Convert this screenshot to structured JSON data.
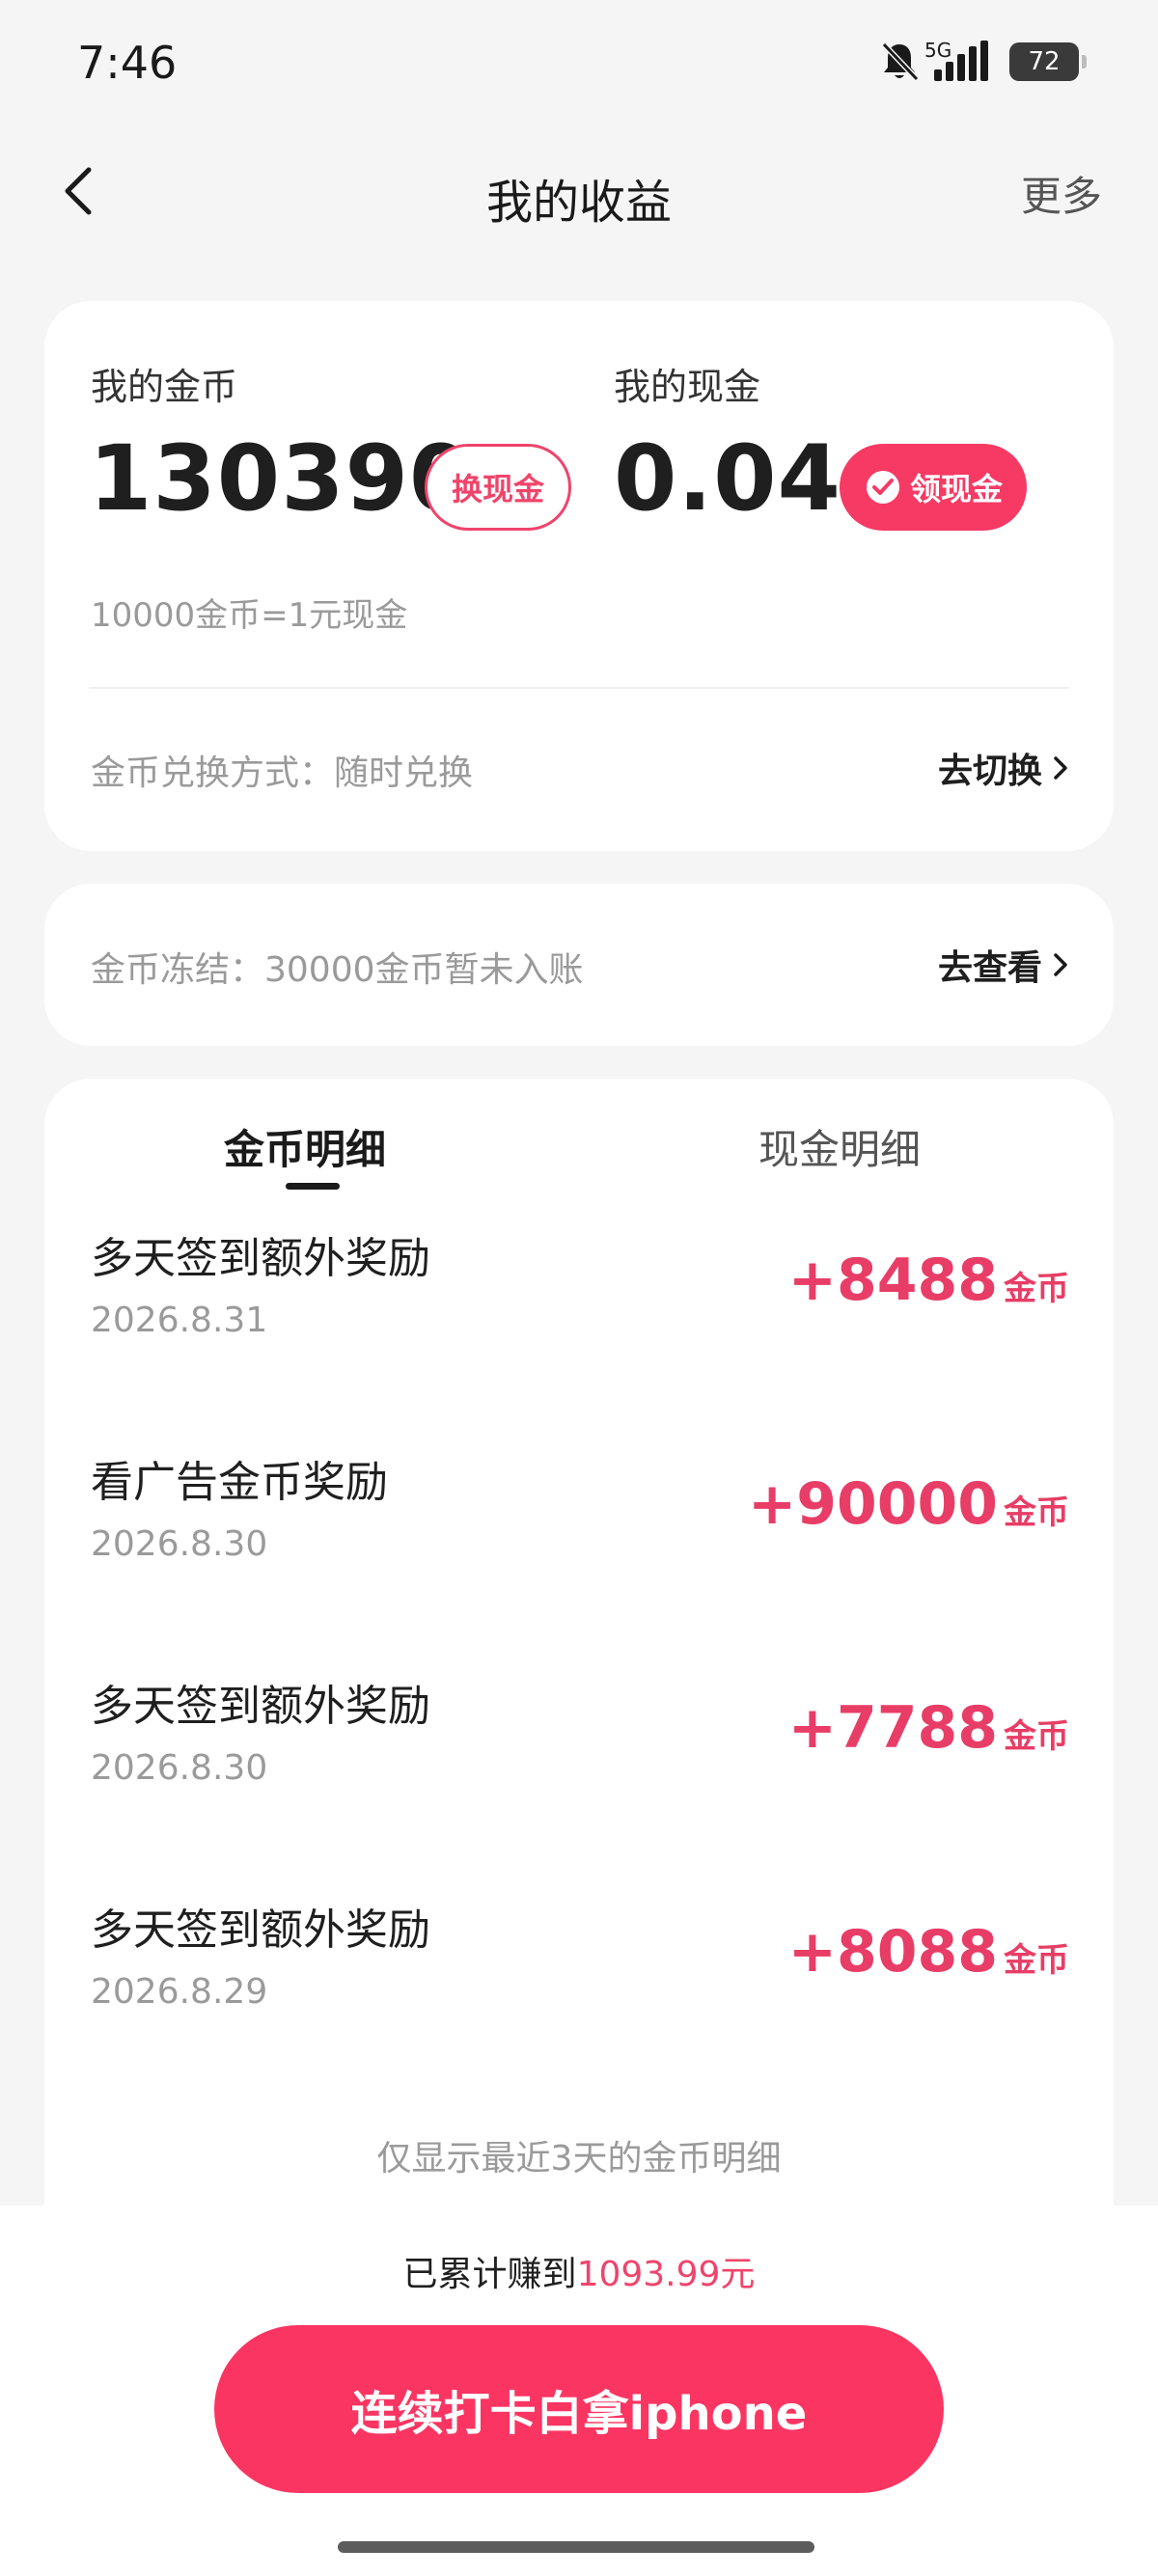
{
  "status_bar": {
    "time": "7:46",
    "network": "5G",
    "battery": "72",
    "icons": [
      "bell-muted-icon",
      "signal-icon",
      "battery-icon"
    ]
  },
  "nav": {
    "title": "我的收益",
    "more": "更多",
    "back_icon": "chevron-left-icon"
  },
  "balance": {
    "coins_label": "我的金币",
    "coins_value": "130390",
    "exchange_button": "换现金",
    "cash_label": "我的现金",
    "cash_value": "0.04",
    "withdraw_button": "领现金",
    "rate": "10000金币=1元现金",
    "exchange_mode": "金币兑换方式：随时兑换",
    "switch_link": "去切换"
  },
  "frozen": {
    "text": "金币冻结：30000金币暂未入账",
    "view_link": "去查看"
  },
  "details": {
    "tabs": [
      {
        "label": "金币明细",
        "active": true
      },
      {
        "label": "现金明细",
        "active": false
      }
    ],
    "transactions": [
      {
        "title": "多天签到额外奖励",
        "date": "2026.8.31",
        "amount": "+8488",
        "unit": "金币"
      },
      {
        "title": "看广告金币奖励",
        "date": "2026.8.30",
        "amount": "+90000",
        "unit": "金币"
      },
      {
        "title": "多天签到额外奖励",
        "date": "2026.8.30",
        "amount": "+7788",
        "unit": "金币"
      },
      {
        "title": "多天签到额外奖励",
        "date": "2026.8.29",
        "amount": "+8088",
        "unit": "金币"
      }
    ],
    "footnote": "仅显示最近3天的金币明细"
  },
  "bottom": {
    "earned_prefix": "已累计赚到",
    "earned_amount": "1093.99元",
    "cta": "连续打卡白拿iphone"
  },
  "colors": {
    "accent": "#f63a64",
    "amount": "#e83d66",
    "background": "#f5f5f5"
  }
}
